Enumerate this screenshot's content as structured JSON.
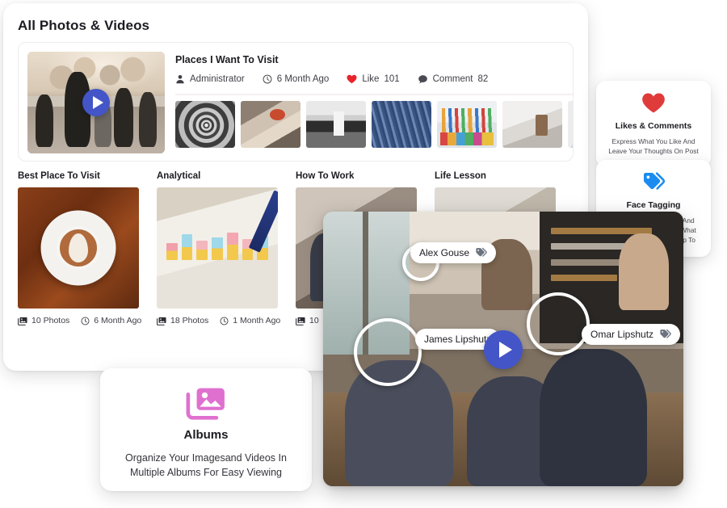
{
  "page": {
    "title": "All Photos & Videos"
  },
  "featured_album": {
    "title": "Places I Want To Visit",
    "author": "Administrator",
    "time": "6 Month Ago",
    "like_label": "Like",
    "like_count": "101",
    "comment_label": "Comment",
    "comment_count": "82",
    "thumbnails": [
      {
        "name": "spiral-staircase"
      },
      {
        "name": "girl-headphones"
      },
      {
        "name": "waterfall-bw"
      },
      {
        "name": "blue-building"
      },
      {
        "name": "colored-pens"
      },
      {
        "name": "desk-coffee"
      },
      {
        "name": "white-shelf"
      }
    ]
  },
  "albums": [
    {
      "name": "Best Place To Visit",
      "photos": "10 Photos",
      "time": "6 Month Ago",
      "cover": "coffee-cup"
    },
    {
      "name": "Analytical",
      "photos": "18 Photos",
      "time": "1 Month Ago",
      "cover": "chart-pen"
    },
    {
      "name": "How To Work",
      "photos": "10",
      "time": "",
      "cover": "classroom"
    },
    {
      "name": "Life Lesson",
      "photos": "",
      "time": "",
      "cover": "life-lesson"
    }
  ],
  "features": [
    {
      "id": "likes",
      "icon": "heart-icon",
      "title": "Likes & Comments",
      "desc": "Express What You Like And Leave Your Thoughts On Post",
      "color": "#e03b3b"
    },
    {
      "id": "face",
      "icon": "tag-icon",
      "title": "Face Tagging",
      "desc": "Tag Your Work Friends And Show Other Collegues What You Guys Have Been Up To",
      "color": "#1a8cf0"
    }
  ],
  "albums_feature": {
    "icon": "image-stack-icon",
    "title": "Albums",
    "desc": "Organize Your Imagesand Videos In Multiple Albums For Easy Viewing",
    "color": "#e070d0"
  },
  "video_overlay": {
    "tags": [
      {
        "name": "Alex Gouse"
      },
      {
        "name": "James Lipshutz"
      },
      {
        "name": "Omar Lipshutz"
      }
    ],
    "play_color": "#4355c7"
  },
  "icons": {
    "person": "person-icon",
    "clock": "clock-icon",
    "heart": "heart-icon",
    "comment": "comment-icon",
    "photos": "photos-icon",
    "play": "play-icon",
    "tag": "tag-icon"
  }
}
